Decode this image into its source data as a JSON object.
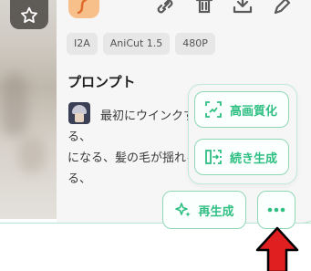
{
  "tags": [
    "I2A",
    "AniCut 1.5",
    "480P"
  ],
  "prompt": {
    "title": "プロンプト",
    "text": "最初にウインクする、\nになる、髪の毛が揺れる\nる、"
  },
  "menu": {
    "items": [
      {
        "label": "高画質化",
        "icon": "upscale-icon"
      },
      {
        "label": "続き生成",
        "icon": "continue-icon"
      }
    ]
  },
  "actions": {
    "regenerate_label": "再生成",
    "more_icon": "more-dots-icon"
  },
  "colors": {
    "accent": "#2fbf83",
    "accent_border": "#8fd8b7",
    "arrow": "#e02020"
  }
}
